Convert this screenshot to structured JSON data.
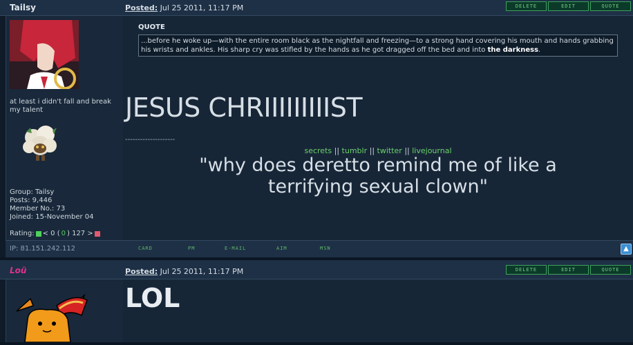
{
  "post1": {
    "username": "Tailsy",
    "posted_label": "Posted:",
    "posted_date": "Jul 25 2011, 11:17 PM",
    "buttons": [
      "DELETE",
      "EDIT",
      "QUOTE"
    ],
    "signature_small": "at least i didn't fall and break my talent",
    "stats": {
      "group": "Group: Tailsy",
      "posts": "Posts: 9,446",
      "member_no": "Member No.: 73",
      "joined": "Joined: 15-November 04"
    },
    "rating": {
      "label": "Rating:",
      "low": "< 0 (",
      "value": "0",
      "high": ") 127 >"
    },
    "quote_label": "QUOTE",
    "quote_text": "...before he woke up—with the entire room black as the nightfall and freezing—to a strong hand covering his mouth and hands grabbing his wrists and ankles. His sharp cry was stifled by the hands as he got dragged off the bed and into",
    "quote_bold": "the darkness",
    "big_text": "JESUS CHRIIIIIIIIIST",
    "dashes": "--------------------",
    "sig_links": [
      "secrets",
      "tumblr",
      "twitter",
      "livejournal"
    ],
    "sig_sep": "||",
    "sig_quote_line1": "\"why does deretto remind me of like a",
    "sig_quote_line2": "terrifying sexual clown\"",
    "ip": "IP: 81.151.242.112",
    "footer_links": [
      "CARD",
      "PM",
      "E-MAIL",
      "AIM",
      "MSN"
    ]
  },
  "post2": {
    "username": "Loü",
    "posted_label": "Posted:",
    "posted_date": "Jul 25 2011, 11:17 PM",
    "buttons": [
      "DELETE",
      "EDIT",
      "QUOTE"
    ],
    "body": "LOL"
  },
  "colors": {
    "background": "#0b1623",
    "accent_green": "#6cd36b",
    "username_pink": "#e0328c",
    "button_border": "#3ea35a"
  },
  "icons": [
    "top-arrow-icon",
    "rating-up-icon",
    "rating-down-icon"
  ]
}
